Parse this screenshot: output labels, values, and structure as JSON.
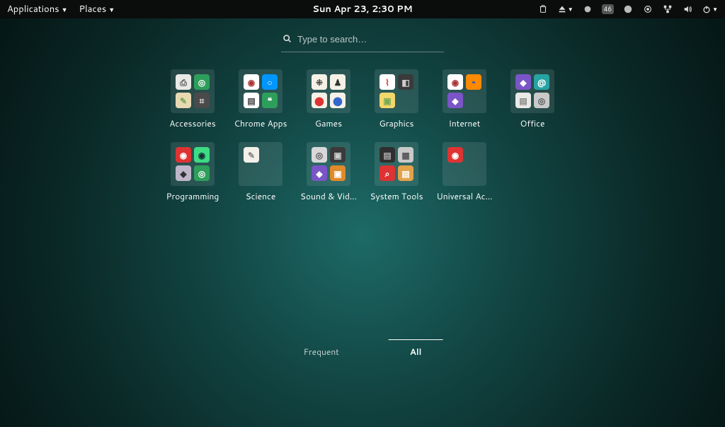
{
  "topbar": {
    "applications": "Applications",
    "places": "Places",
    "clock": "Sun Apr 23,  2:30 PM",
    "battery_badge": "46"
  },
  "search": {
    "placeholder": "Type to search…"
  },
  "categories": [
    {
      "label": "Accessories",
      "icons": [
        {
          "name": "printer",
          "bg": "#e9e9e7",
          "fg": "#555",
          "char": "⎙"
        },
        {
          "name": "green-round",
          "bg": "#2e9e5b",
          "fg": "#fff",
          "char": "◎"
        },
        {
          "name": "notes",
          "bg": "#e9d9b3",
          "fg": "#7a5",
          "char": "✎"
        },
        {
          "name": "calculator",
          "bg": "#4a4a4a",
          "fg": "#ddd",
          "char": "⌗"
        }
      ]
    },
    {
      "label": "Chrome Apps",
      "icons": [
        {
          "name": "chrome",
          "bg": "#ffffff",
          "fg": "#a33",
          "char": "◉"
        },
        {
          "name": "camera",
          "bg": "#0096ff",
          "fg": "#fff",
          "char": "○"
        },
        {
          "name": "docs",
          "bg": "#ffffff",
          "fg": "#444",
          "char": "▤"
        },
        {
          "name": "hangouts",
          "bg": "#2e9e5b",
          "fg": "#fff",
          "char": "❝"
        }
      ]
    },
    {
      "label": "Games",
      "icons": [
        {
          "name": "dice",
          "bg": "#f5f1e6",
          "fg": "#333",
          "char": "⁜"
        },
        {
          "name": "chess",
          "bg": "#f5f1e6",
          "fg": "#333",
          "char": "♟"
        },
        {
          "name": "ball",
          "bg": "#f5f1e6",
          "fg": "#d33",
          "char": "⬤"
        },
        {
          "name": "ball2",
          "bg": "#f5f1e6",
          "fg": "#36c",
          "char": "⬤"
        }
      ]
    },
    {
      "label": "Graphics",
      "icons": [
        {
          "name": "pdf",
          "bg": "#ffffff",
          "fg": "#d33",
          "char": "⌇"
        },
        {
          "name": "camera2",
          "bg": "#3a3a3a",
          "fg": "#ccc",
          "char": "◧"
        },
        {
          "name": "image",
          "bg": "#f4d66a",
          "fg": "#7a5",
          "char": "▣"
        },
        {
          "name": "blank",
          "bg": "transparent",
          "fg": "transparent",
          "char": " "
        }
      ]
    },
    {
      "label": "Internet",
      "icons": [
        {
          "name": "chrome2",
          "bg": "#ffffff",
          "fg": "#a33",
          "char": "◉"
        },
        {
          "name": "firefox",
          "bg": "#ff8a00",
          "fg": "#2a56c6",
          "char": "◓"
        },
        {
          "name": "purple",
          "bg": "#7a55c7",
          "fg": "#fff",
          "char": "◆"
        },
        {
          "name": "blank",
          "bg": "transparent",
          "fg": "transparent",
          "char": " "
        }
      ]
    },
    {
      "label": "Office",
      "icons": [
        {
          "name": "purple2",
          "bg": "#7a55c7",
          "fg": "#fff",
          "char": "◆"
        },
        {
          "name": "at",
          "bg": "#27a3a3",
          "fg": "#fff",
          "char": "@"
        },
        {
          "name": "doc",
          "bg": "#e9e9e7",
          "fg": "#888",
          "char": "▤"
        },
        {
          "name": "disk",
          "bg": "#c9c9c9",
          "fg": "#555",
          "char": "◎"
        }
      ]
    },
    {
      "label": "Programming",
      "icons": [
        {
          "name": "red",
          "bg": "#d33",
          "fg": "#fff",
          "char": "◉"
        },
        {
          "name": "android",
          "bg": "#3ddc84",
          "fg": "#133",
          "char": "◉"
        },
        {
          "name": "unity",
          "bg": "#bfb7c9",
          "fg": "#333",
          "char": "◆"
        },
        {
          "name": "green2",
          "bg": "#2e9e5b",
          "fg": "#fff",
          "char": "◎"
        }
      ]
    },
    {
      "label": "Science",
      "icons": [
        {
          "name": "doc2",
          "bg": "#f3f0ea",
          "fg": "#888",
          "char": "✎"
        },
        {
          "name": "blank",
          "bg": "transparent",
          "fg": "transparent",
          "char": " "
        },
        {
          "name": "blank",
          "bg": "transparent",
          "fg": "transparent",
          "char": " "
        },
        {
          "name": "blank",
          "bg": "transparent",
          "fg": "transparent",
          "char": " "
        }
      ]
    },
    {
      "label": "Sound & Vid…",
      "icons": [
        {
          "name": "disc",
          "bg": "#d8d8d8",
          "fg": "#555",
          "char": "◎"
        },
        {
          "name": "cam",
          "bg": "#3a3a3a",
          "fg": "#ccc",
          "char": "▣"
        },
        {
          "name": "purple3",
          "bg": "#7a55c7",
          "fg": "#fff",
          "char": "◆"
        },
        {
          "name": "orange",
          "bg": "#e08a2a",
          "fg": "#fff",
          "char": "▣"
        }
      ]
    },
    {
      "label": "System Tools",
      "icons": [
        {
          "name": "dark",
          "bg": "#2f2f2f",
          "fg": "#aaa",
          "char": "▤"
        },
        {
          "name": "box",
          "bg": "#c9c9c9",
          "fg": "#555",
          "char": "▦"
        },
        {
          "name": "red2",
          "bg": "#d33",
          "fg": "#fff",
          "char": "⌕"
        },
        {
          "name": "folder",
          "bg": "#e3a34a",
          "fg": "#fff",
          "char": "▤"
        }
      ]
    },
    {
      "label": "Universal Ac…",
      "icons": [
        {
          "name": "red3",
          "bg": "#d33",
          "fg": "#fff",
          "char": "◉"
        },
        {
          "name": "blank",
          "bg": "transparent",
          "fg": "transparent",
          "char": " "
        },
        {
          "name": "blank",
          "bg": "transparent",
          "fg": "transparent",
          "char": " "
        },
        {
          "name": "blank",
          "bg": "transparent",
          "fg": "transparent",
          "char": " "
        }
      ]
    }
  ],
  "tabs": {
    "frequent": "Frequent",
    "all": "All",
    "active": "all"
  }
}
